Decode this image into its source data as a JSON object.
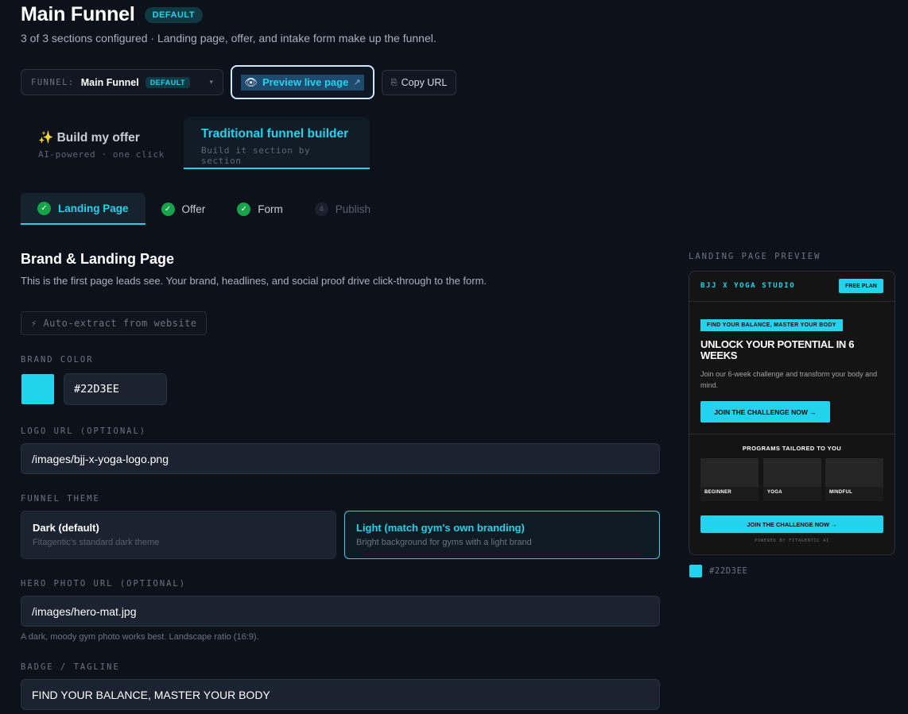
{
  "header": {
    "title": "Main Funnel",
    "badge": "DEFAULT",
    "subtitle": "3 of 3 sections configured · Landing page, offer, and intake form make up the funnel."
  },
  "toolbar": {
    "funnel_label": "FUNNEL:",
    "funnel_value": "Main Funnel",
    "funnel_badge": "DEFAULT",
    "preview_icon": "eye-icon",
    "preview_label": "Preview live page",
    "preview_ext_icon": "external-link-icon",
    "copy_label": "Copy URL",
    "copy_icon": "copy-icon"
  },
  "mode_tabs": [
    {
      "title": "✨ Build my offer",
      "subtitle": "AI-powered · one click",
      "active": false
    },
    {
      "title": "Traditional funnel builder",
      "subtitle": "Build it section by section",
      "active": true
    }
  ],
  "steps": [
    {
      "label": "Landing Page",
      "status": "done",
      "marker": "✓",
      "active": true
    },
    {
      "label": "Offer",
      "status": "done",
      "marker": "✓",
      "active": false
    },
    {
      "label": "Form",
      "status": "done",
      "marker": "✓",
      "active": false
    },
    {
      "label": "Publish",
      "status": "pending",
      "marker": "4",
      "active": false
    }
  ],
  "section": {
    "title": "Brand & Landing Page",
    "description": "This is the first page leads see. Your brand, headlines, and social proof drive click-through to the form.",
    "auto_extract_label": "⚡ Auto-extract from website"
  },
  "fields": {
    "brand_color_label": "BRAND COLOR",
    "brand_color_value": "#22D3EE",
    "logo_label": "LOGO URL (OPTIONAL)",
    "logo_value": "/images/bjj-x-yoga-logo.png",
    "theme_label": "FUNNEL THEME",
    "themes": [
      {
        "title": "Dark (default)",
        "subtitle": "Fitagentic's standard dark theme",
        "selected": false
      },
      {
        "title": "Light (match gym's own branding)",
        "subtitle": "Bright background for gyms with a light brand",
        "selected": true
      }
    ],
    "hero_label": "HERO PHOTO URL (OPTIONAL)",
    "hero_value": "/images/hero-mat.jpg",
    "hero_helper": "A dark, moody gym photo works best. Landscape ratio (16:9).",
    "badge_label": "BADGE / TAGLINE",
    "badge_value": "FIND YOUR BALANCE, MASTER YOUR BODY"
  },
  "preview": {
    "label": "LANDING PAGE PREVIEW",
    "brand": "BJJ X YOGA STUDIO",
    "nav_button": "FREE PLAN",
    "badge": "FIND YOUR BALANCE, MASTER YOUR BODY",
    "headline": "UNLOCK YOUR POTENTIAL IN 6 WEEKS",
    "subheadline": "Join our 6-week challenge and transform your body and mind.",
    "cta": "JOIN THE CHALLENGE NOW →",
    "programs_title": "PROGRAMS TAILORED TO YOU",
    "programs": [
      "BEGINNER",
      "YOGA",
      "MINDFUL"
    ],
    "cta_bottom": "JOIN THE CHALLENGE NOW →",
    "powered_by": "POWERED BY FITAGENTIC AI",
    "color_hex": "#22D3EE"
  },
  "colors": {
    "accent": "#22d3ee",
    "success": "#16a34a",
    "background": "#0d111a"
  }
}
